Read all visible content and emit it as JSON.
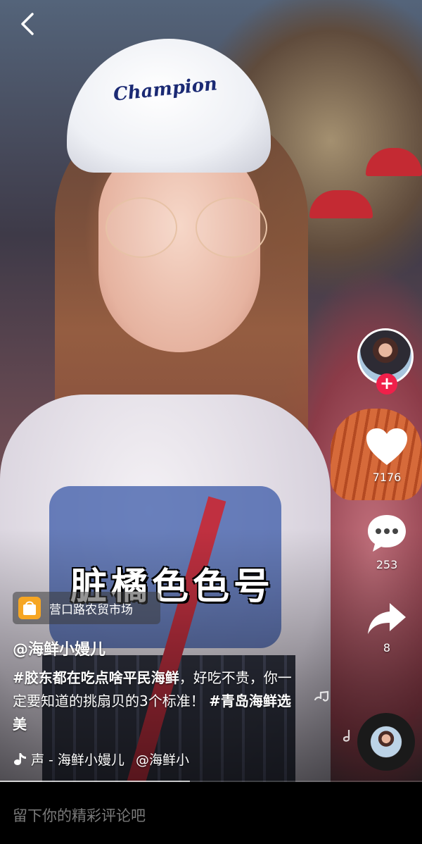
{
  "video": {
    "cap_logo": "Champion",
    "overlay_caption": "脏橘色色号",
    "progress": 0.45
  },
  "nav": {
    "back_icon": "chevron-left-icon"
  },
  "rail": {
    "like_count": "7176",
    "comment_count": "253",
    "share_count": "8",
    "follow_icon": "plus-icon"
  },
  "location": {
    "icon": "shopping-bag-icon",
    "label": "营口路农贸市场"
  },
  "post": {
    "author": "@海鲜小嫚儿",
    "desc_tag1": "#胶东都在吃点啥平民海鲜",
    "desc_text": "，好吃不贵，你一定要知道的挑扇贝的3个标准！",
    "desc_tag2": "#青岛海鲜选美"
  },
  "music": {
    "icon": "music-note-icon",
    "prefix": "声 - 海鲜小嫚儿",
    "author": "@海鲜小"
  },
  "comment": {
    "placeholder": "留下你的精彩评论吧"
  },
  "colors": {
    "accent": "#f0204a",
    "background": "#000000"
  }
}
